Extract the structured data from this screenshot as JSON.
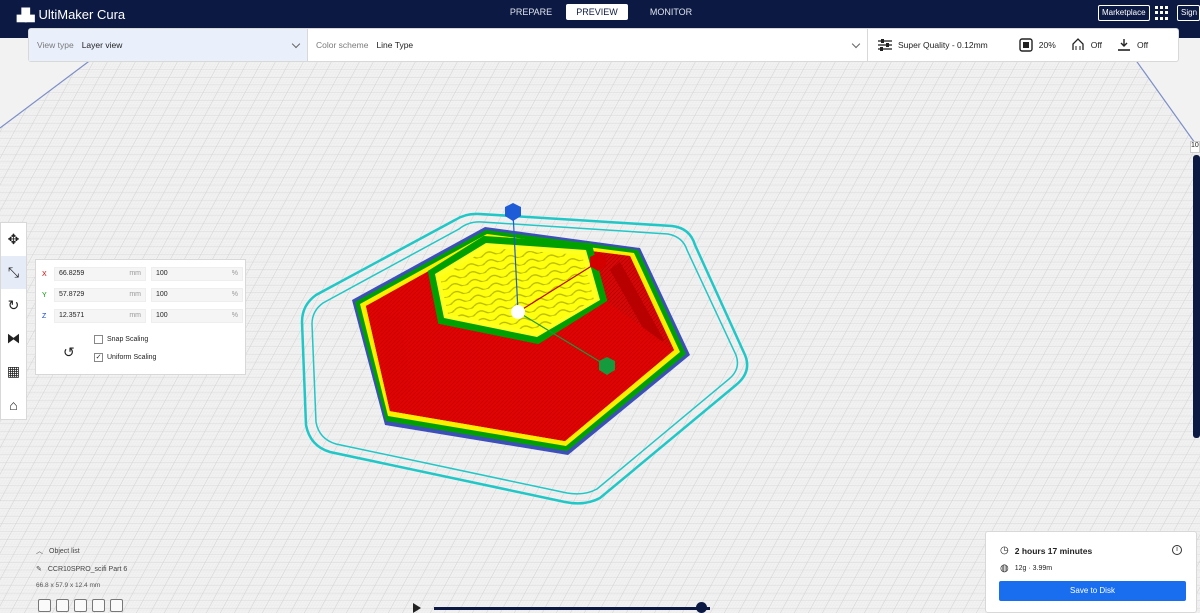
{
  "app": {
    "title": "UltiMaker Cura"
  },
  "stages": [
    {
      "label": "PREPARE"
    },
    {
      "label": "PREVIEW"
    },
    {
      "label": "MONITOR"
    }
  ],
  "header": {
    "marketplace": "Marketplace",
    "signin": "Sign in"
  },
  "toolbar": {
    "view_type_label": "View type",
    "view_type_value": "Layer view",
    "color_scheme_label": "Color scheme",
    "color_scheme_value": "Line Type",
    "quality": "Super Quality - 0.12mm",
    "infill": "20%",
    "support": "Off",
    "adhesion": "Off"
  },
  "scale_panel": {
    "x_label": "X",
    "x_mm": "66.8259",
    "x_pct": "100",
    "y_label": "Y",
    "y_mm": "57.8729",
    "y_pct": "100",
    "z_label": "Z",
    "z_mm": "12.3571",
    "z_pct": "100",
    "unit_mm": "mm",
    "unit_pct": "%",
    "snap_scaling": "Snap Scaling",
    "uniform_scaling": "Uniform Scaling"
  },
  "object_list": {
    "title": "Object list",
    "item": "CCR10SPRO_scifi Part 6",
    "dimensions": "66.8 x 57.9 x 12.4 mm"
  },
  "layer_slider": {
    "value": "10"
  },
  "summary": {
    "print_time": "2 hours 17 minutes",
    "material": "12g · 3.99m",
    "save_button": "Save to Disk"
  },
  "colors": {
    "header_bg": "#0c1a43",
    "accent": "#196ef0",
    "wall_outer": "#e8000b",
    "infill": "#ffff00",
    "wall_inner": "#00a000",
    "skirt": "#20d8d8"
  }
}
